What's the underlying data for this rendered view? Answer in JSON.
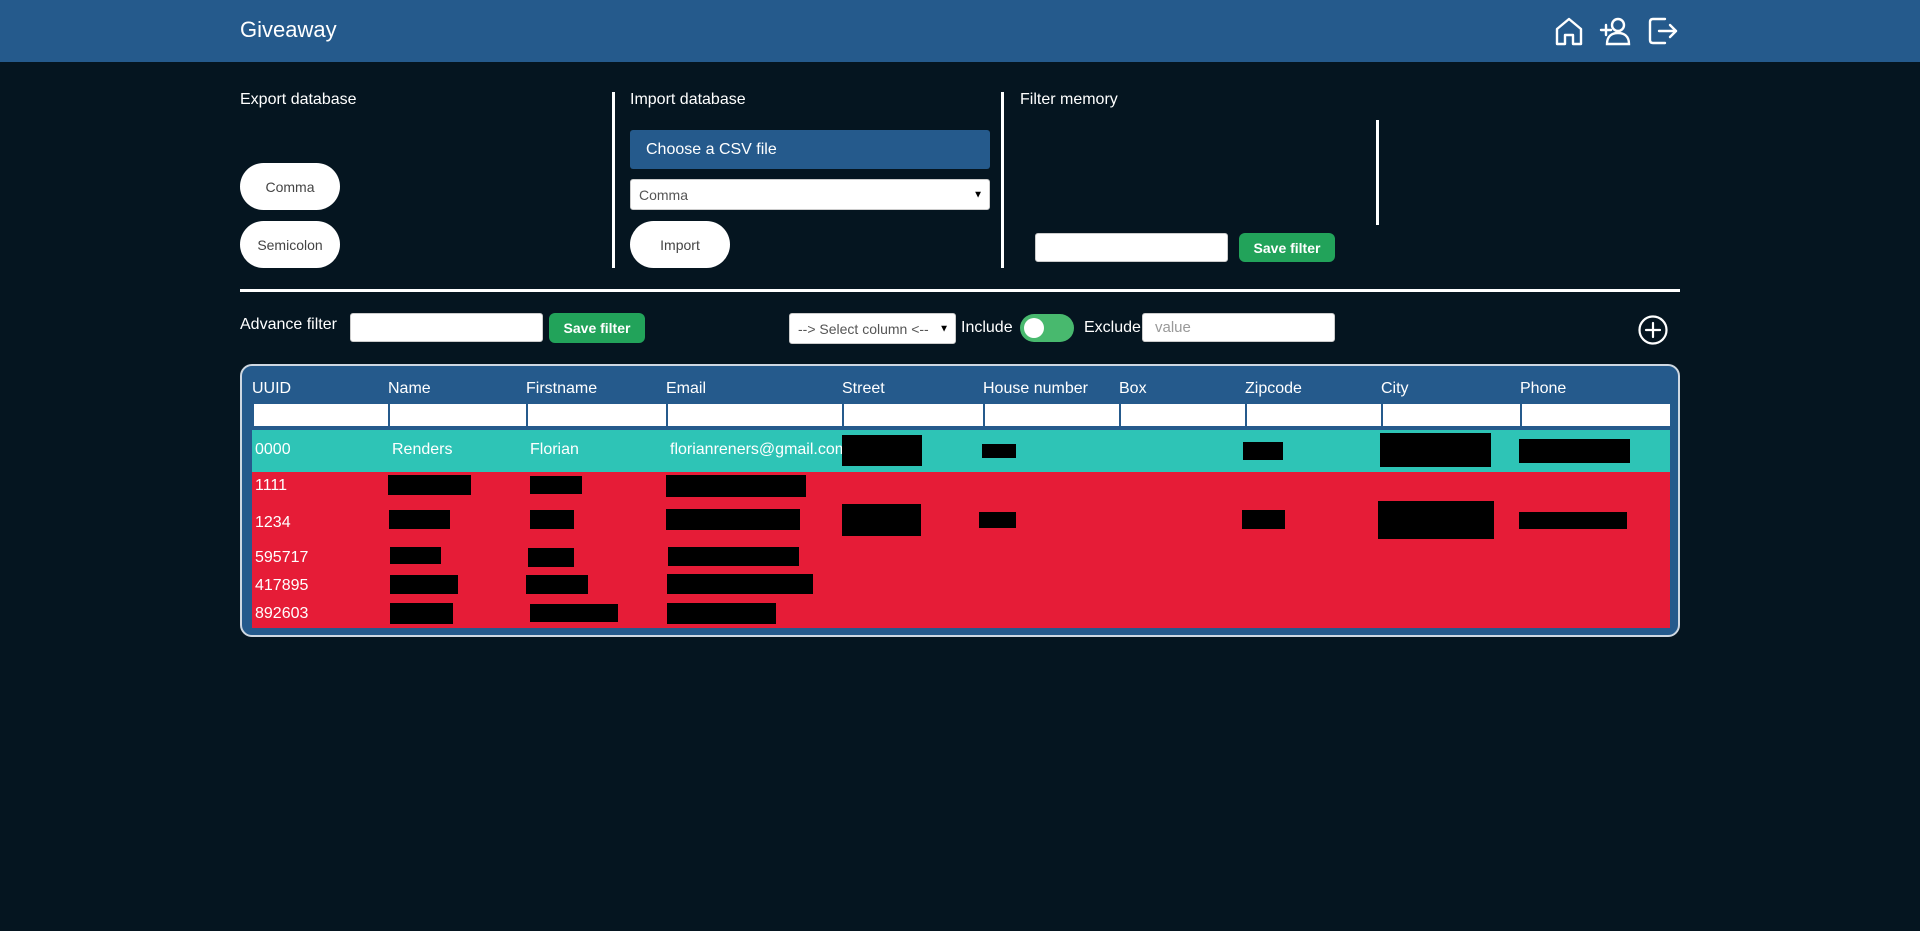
{
  "header": {
    "title": "Giveaway",
    "icons": [
      "home-icon",
      "add-user-icon",
      "logout-icon"
    ]
  },
  "export": {
    "title": "Export database",
    "comma_label": "Comma",
    "semicolon_label": "Semicolon"
  },
  "import": {
    "title": "Import database",
    "file_label": "Choose a CSV file",
    "delimiter_selected": "Comma",
    "import_label": "Import"
  },
  "filter_memory": {
    "title": "Filter memory",
    "name_value": "",
    "save_label": "Save filter"
  },
  "advance_filter": {
    "label": "Advance filter",
    "name_value": "",
    "save_label": "Save filter",
    "column_select": "--> Select column <--",
    "include_label": "Include",
    "exclude_label": "Exclude",
    "value_placeholder": "value"
  },
  "table": {
    "columns": [
      "UUID",
      "Name",
      "Firstname",
      "Email",
      "Street",
      "House number",
      "Box",
      "Zipcode",
      "City",
      "Phone"
    ],
    "rows": [
      {
        "uuid": "0000",
        "name": "Renders",
        "firstname": "Florian",
        "email": "florianreners@gmail.com",
        "status": "highlight"
      },
      {
        "uuid": "1111",
        "status": "alert"
      },
      {
        "uuid": "1234",
        "status": "alert"
      },
      {
        "uuid": "595717",
        "status": "alert"
      },
      {
        "uuid": "417895",
        "status": "alert"
      },
      {
        "uuid": "892603",
        "status": "alert"
      }
    ]
  },
  "colors": {
    "header_bg": "#255a8c",
    "page_bg": "#051520",
    "highlight_row": "#2ec4b6",
    "alert_row": "#e61c37",
    "save_button": "#22a35a"
  }
}
